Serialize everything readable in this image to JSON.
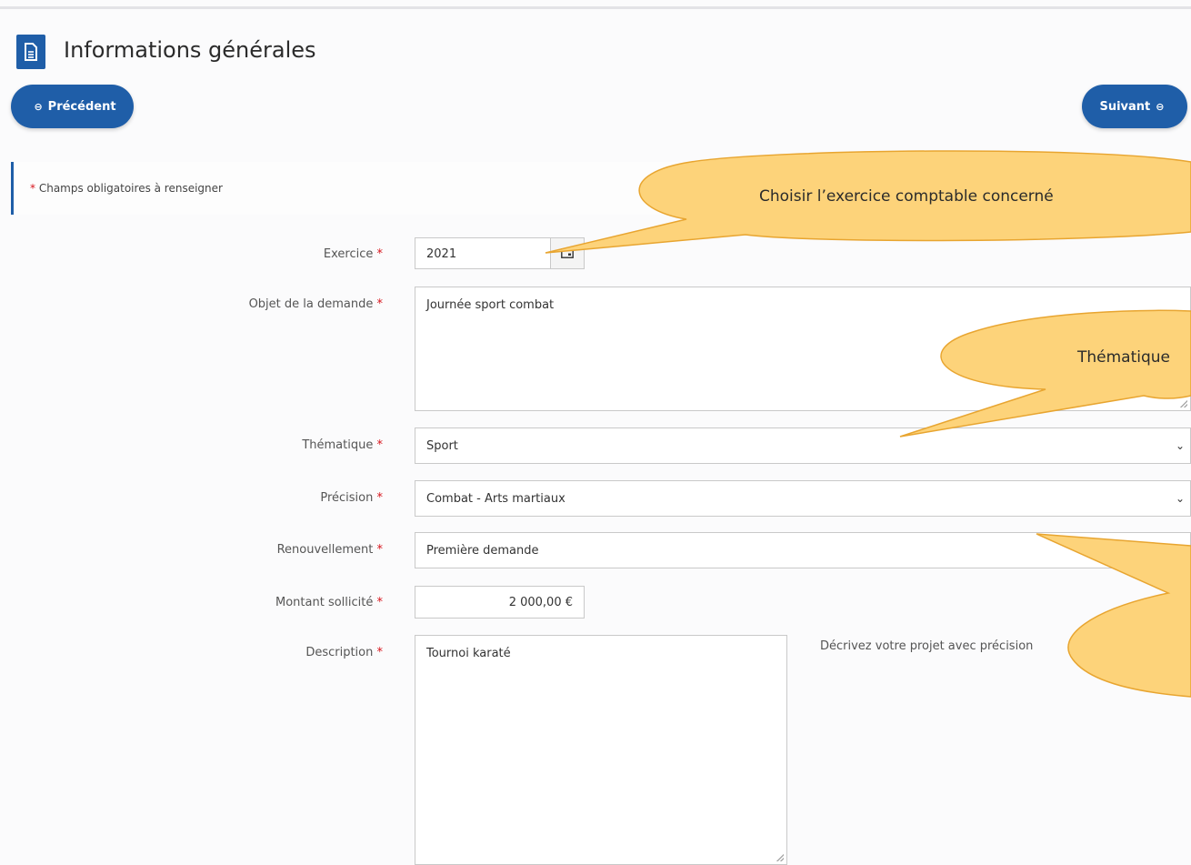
{
  "page": {
    "title": "Informations générales",
    "title_icon": "document-icon"
  },
  "nav": {
    "prev_label": "Précédent",
    "next_label": "Suivant"
  },
  "notice": {
    "star": "*",
    "text": "Champs obligatoires à renseigner"
  },
  "form": {
    "required_mark": "*",
    "exercice": {
      "label": "Exercice",
      "value": "2021"
    },
    "objet": {
      "label": "Objet de la demande",
      "value": "Journée sport combat"
    },
    "thematique": {
      "label": "Thématique",
      "value": "Sport"
    },
    "precision": {
      "label": "Précision",
      "value": "Combat - Arts martiaux"
    },
    "renouvellement": {
      "label": "Renouvellement",
      "value": "Première demande"
    },
    "montant": {
      "label": "Montant sollicité",
      "value": "2 000,00 €"
    },
    "description": {
      "label": "Description",
      "value": "Tournoi karaté",
      "hint": "Décrivez votre projet avec précision"
    }
  },
  "callouts": {
    "exercice": "Choisir l’exercice comptable concerné",
    "thematique": "Thématique"
  },
  "colors": {
    "primary": "#1f5ea8",
    "required": "#d7141c",
    "callout_fill": "#fdd37a",
    "callout_stroke": "#e8a530"
  }
}
